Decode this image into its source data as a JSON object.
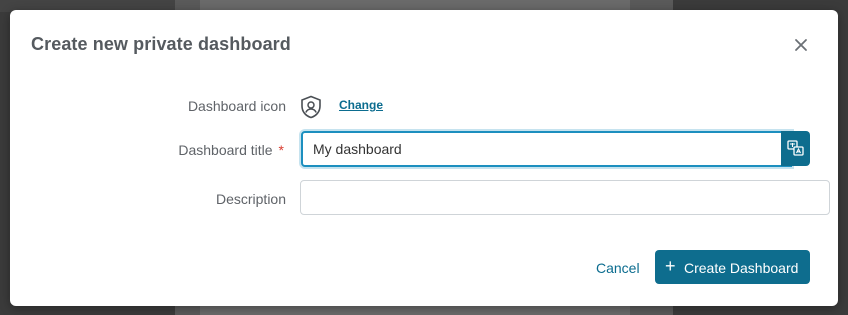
{
  "dialog": {
    "title": "Create new private dashboard",
    "close_icon": "close-icon"
  },
  "fields": {
    "icon_label": "Dashboard icon",
    "icon_name": "user-shield-icon",
    "change_link": "Change",
    "title_label": "Dashboard title",
    "title_required_mark": "*",
    "title_value": "My dashboard",
    "translate_icon": "translate-icon",
    "description_label": "Description",
    "description_value": ""
  },
  "actions": {
    "cancel": "Cancel",
    "create_icon": "plus-icon",
    "create": "Create Dashboard"
  },
  "colors": {
    "primary": "#0e6d8e",
    "focus_border": "#1c8fbf",
    "link": "#0b6c8f",
    "required": "#d93b2f",
    "overlay": "#3b3b3b"
  }
}
